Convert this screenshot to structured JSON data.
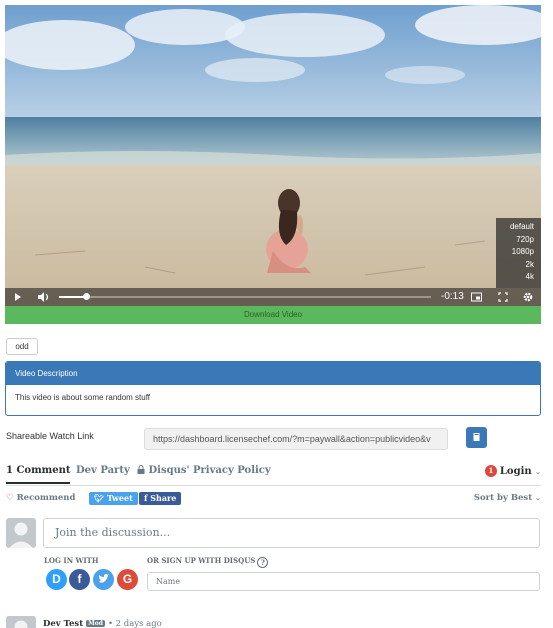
{
  "video": {
    "time_remaining": "-0:13",
    "progress_fraction": 0.03,
    "quality_options": [
      "default",
      "720p",
      "1080p",
      "2k",
      "4k"
    ]
  },
  "download_label": "Download Video",
  "odd_button": "odd",
  "description": {
    "heading": "Video Description",
    "body": "This video is about some random stuff"
  },
  "share": {
    "label": "Shareable Watch Link",
    "url": "https://dashboard.licensechef.com/?m=paywall&action=publicvideo&v"
  },
  "disqus": {
    "tabs": [
      "1 Comment",
      "Dev Party",
      "Disqus' Privacy Policy"
    ],
    "login_count": "1",
    "login_label": "Login",
    "recommend_label": "Recommend",
    "tweet_label": "Tweet",
    "share_label": "Share",
    "sort_label": "Sort by Best",
    "discussion_placeholder": "Join the discussion...",
    "login_with_label": "LOG IN WITH",
    "signup_label": "OR SIGN UP WITH DISQUS",
    "social_letters": [
      "D",
      "f",
      "t",
      "G"
    ],
    "name_placeholder": "Name",
    "comment": {
      "author": "Dev Test",
      "badge": "Mod",
      "time": "• 2 days ago"
    }
  },
  "colors": {
    "primary": "#3a78b8",
    "download_green": "#5cb85c",
    "disqus_blue": "#2e9fff",
    "facebook": "#3b5a99",
    "twitter": "#4aa1ec",
    "google": "#dd4b39"
  }
}
